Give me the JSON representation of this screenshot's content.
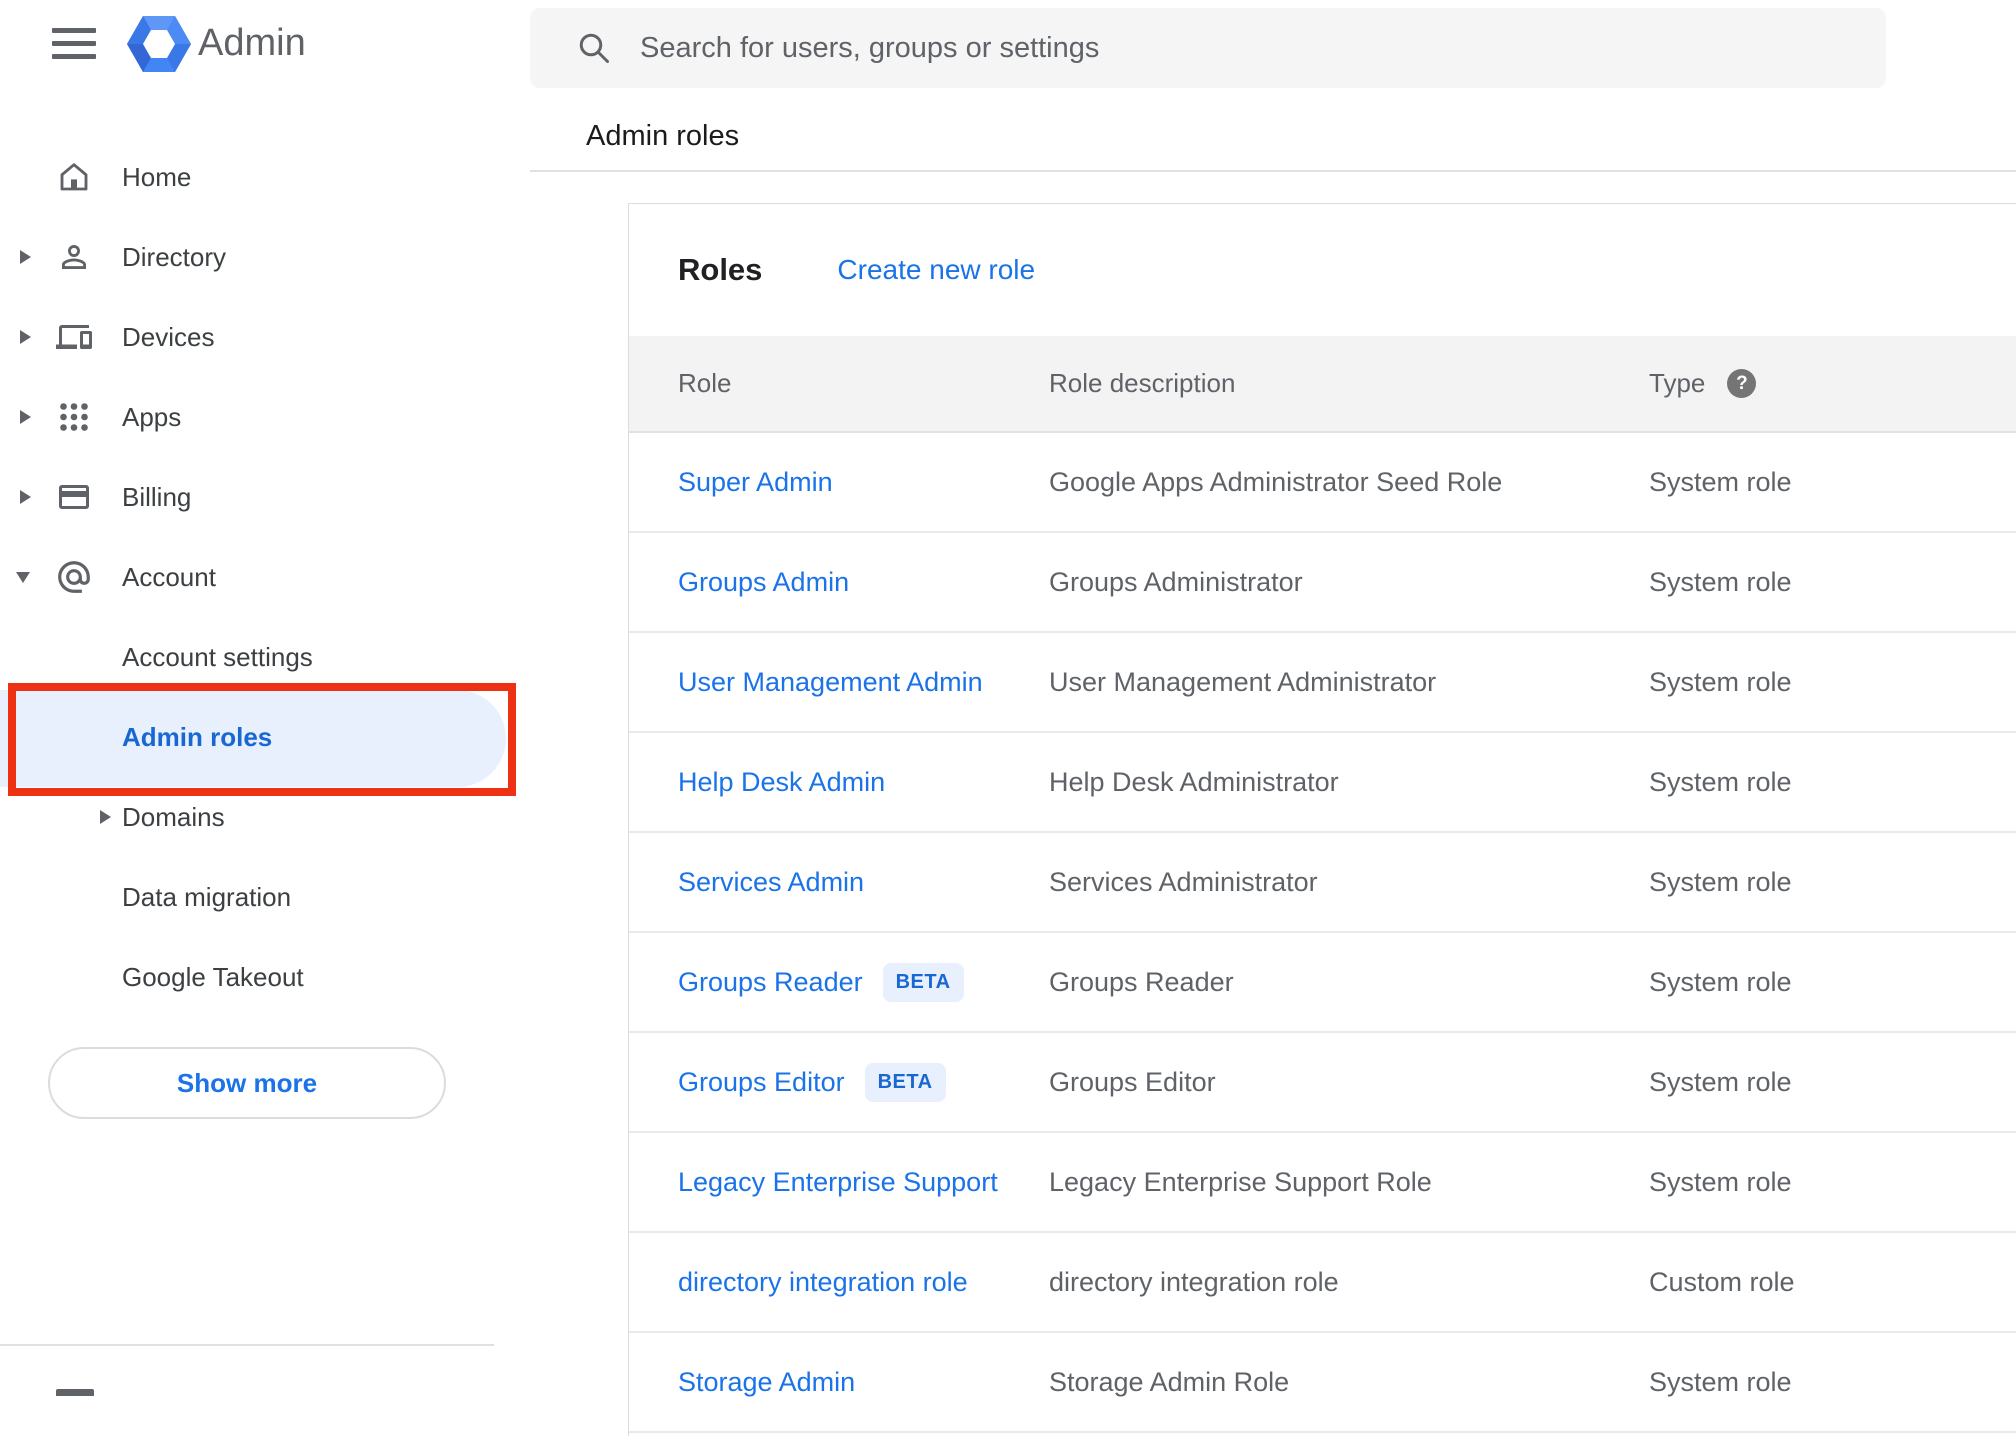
{
  "header": {
    "app_title": "Admin",
    "search_placeholder": "Search for users, groups or settings",
    "breadcrumb": "Admin roles"
  },
  "sidebar": {
    "items": [
      {
        "label": "Home",
        "icon": "home-icon",
        "expandable": false
      },
      {
        "label": "Directory",
        "icon": "person-icon",
        "expandable": true
      },
      {
        "label": "Devices",
        "icon": "devices-icon",
        "expandable": true
      },
      {
        "label": "Apps",
        "icon": "apps-grid-icon",
        "expandable": true
      },
      {
        "label": "Billing",
        "icon": "credit-card-icon",
        "expandable": true
      },
      {
        "label": "Account",
        "icon": "at-sign-icon",
        "expandable": true,
        "expanded": true
      }
    ],
    "account_children": [
      {
        "label": "Account settings"
      },
      {
        "label": "Admin roles",
        "selected": true,
        "annotated": true
      },
      {
        "label": "Domains",
        "expandable": true
      },
      {
        "label": "Data migration"
      },
      {
        "label": "Google Takeout"
      }
    ],
    "show_more_label": "Show more"
  },
  "main": {
    "card_title": "Roles",
    "create_link": "Create new role",
    "table": {
      "columns": [
        "Role",
        "Role description",
        "Type"
      ],
      "beta_label": "BETA",
      "rows": [
        {
          "role": "Super Admin",
          "description": "Google Apps Administrator Seed Role",
          "type": "System role"
        },
        {
          "role": "Groups Admin",
          "description": "Groups Administrator",
          "type": "System role"
        },
        {
          "role": "User Management Admin",
          "description": "User Management Administrator",
          "type": "System role"
        },
        {
          "role": "Help Desk Admin",
          "description": "Help Desk Administrator",
          "type": "System role"
        },
        {
          "role": "Services Admin",
          "description": "Services Administrator",
          "type": "System role"
        },
        {
          "role": "Groups Reader",
          "beta": true,
          "description": "Groups Reader",
          "type": "System role"
        },
        {
          "role": "Groups Editor",
          "beta": true,
          "description": "Groups Editor",
          "type": "System role"
        },
        {
          "role": "Legacy Enterprise Support",
          "description": "Legacy Enterprise Support Role",
          "type": "System role"
        },
        {
          "role": "directory integration role",
          "description": "directory integration role",
          "type": "Custom role"
        },
        {
          "role": "Storage Admin",
          "description": "Storage Admin Role",
          "type": "System role"
        }
      ]
    }
  },
  "icons": {
    "menu": "hamburger-menu",
    "search": "magnifier",
    "type_help": "question-mark-circle",
    "annotation": "red-highlight-box"
  },
  "colors": {
    "accent_blue": "#1a73e8",
    "selected_blue": "#1967d2",
    "selected_bg": "#e8f0fe",
    "annotation_red": "#ec3212",
    "header_gray_bg": "#f3f3f3",
    "search_bg": "#f5f5f5",
    "text_primary": "#202124",
    "text_secondary": "#5f6368"
  }
}
